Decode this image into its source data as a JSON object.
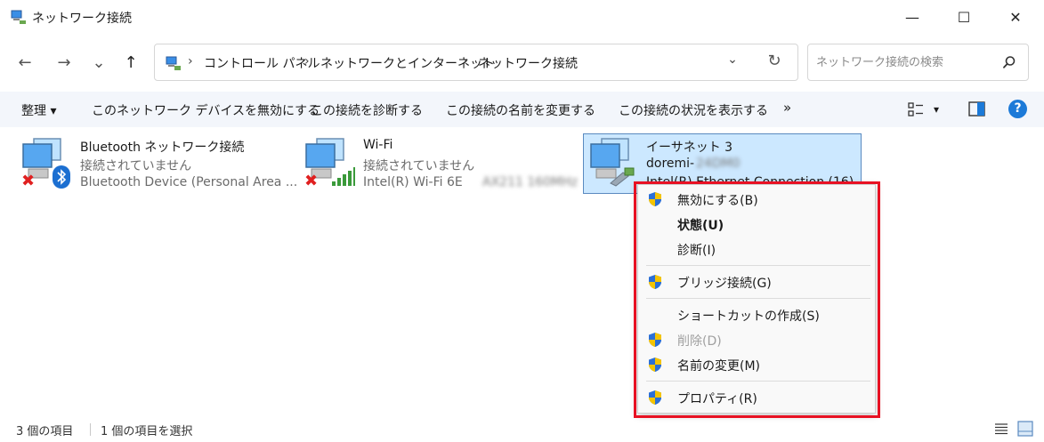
{
  "window": {
    "title": "ネットワーク接続",
    "minimize_glyph": "—",
    "maximize_glyph": "☐",
    "close_glyph": "✕"
  },
  "nav": {
    "back_glyph": "←",
    "forward_glyph": "→",
    "recent_glyph": "⌄",
    "up_glyph": "↑"
  },
  "address": {
    "crumbs": [
      "コントロール パネル",
      "ネットワークとインターネット",
      "ネットワーク接続"
    ],
    "separator": "›",
    "dropdown_glyph": "⌄",
    "refresh_glyph": "↻"
  },
  "search": {
    "placeholder": "ネットワーク接続の検索",
    "value": ""
  },
  "toolbar": {
    "organize": "整理 ▾",
    "disable_device": "このネットワーク デバイスを無効にする",
    "diagnose": "この接続を診断する",
    "rename": "この接続の名前を変更する",
    "view_status": "この接続の状況を表示する",
    "more": "»",
    "view_dropdown": "▾",
    "help": "?"
  },
  "connections": [
    {
      "name": "Bluetooth ネットワーク接続",
      "status": "接続されていません",
      "device": "Bluetooth Device (Personal Area ..."
    },
    {
      "name": "Wi-Fi",
      "status": "接続されていません",
      "device": "Intel(R) Wi-Fi 6E",
      "device_blurred": "AX211 160MHz"
    },
    {
      "name": "イーサネット 3",
      "status": "doremi-",
      "status_blurred": "24DM0",
      "device": "Intel(R) Ethernet Connection (16) I..."
    }
  ],
  "context_menu": {
    "items": [
      {
        "label": "無効にする(B)",
        "shield": true
      },
      {
        "label": "状態(U)",
        "shield": false,
        "bold": true
      },
      {
        "label": "診断(I)",
        "shield": false
      },
      {
        "label": "ブリッジ接続(G)",
        "shield": true
      },
      {
        "label": "ショートカットの作成(S)",
        "shield": false
      },
      {
        "label": "削除(D)",
        "shield": true,
        "disabled": true
      },
      {
        "label": "名前の変更(M)",
        "shield": true
      },
      {
        "label": "プロパティ(R)",
        "shield": true
      }
    ]
  },
  "statusbar": {
    "item_count": "3 個の項目",
    "selected_count": "1 個の項目を選択"
  },
  "colors": {
    "selection_bg": "#cce8ff",
    "highlight_frame": "#e81123",
    "help_blue": "#1c7ad8"
  }
}
